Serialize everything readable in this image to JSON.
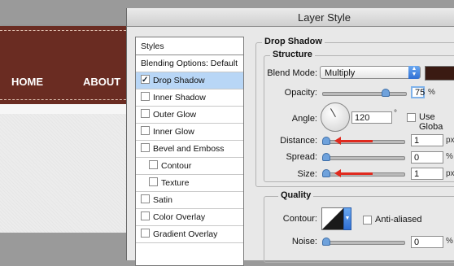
{
  "background": {
    "nav_links": [
      "HOME",
      "ABOUT"
    ]
  },
  "dialog": {
    "title": "Layer Style",
    "styles_list": {
      "header": "Styles",
      "items": [
        {
          "label": "Blending Options: Default",
          "checkbox": false,
          "checked": false,
          "selected": false,
          "indent": false
        },
        {
          "label": "Drop Shadow",
          "checkbox": true,
          "checked": true,
          "selected": true,
          "indent": false
        },
        {
          "label": "Inner Shadow",
          "checkbox": true,
          "checked": false,
          "selected": false,
          "indent": false
        },
        {
          "label": "Outer Glow",
          "checkbox": true,
          "checked": false,
          "selected": false,
          "indent": false
        },
        {
          "label": "Inner Glow",
          "checkbox": true,
          "checked": false,
          "selected": false,
          "indent": false
        },
        {
          "label": "Bevel and Emboss",
          "checkbox": true,
          "checked": false,
          "selected": false,
          "indent": false
        },
        {
          "label": "Contour",
          "checkbox": true,
          "checked": false,
          "selected": false,
          "indent": true
        },
        {
          "label": "Texture",
          "checkbox": true,
          "checked": false,
          "selected": false,
          "indent": true
        },
        {
          "label": "Satin",
          "checkbox": true,
          "checked": false,
          "selected": false,
          "indent": false
        },
        {
          "label": "Color Overlay",
          "checkbox": true,
          "checked": false,
          "selected": false,
          "indent": false
        },
        {
          "label": "Gradient Overlay",
          "checkbox": true,
          "checked": false,
          "selected": false,
          "indent": false
        }
      ]
    },
    "drop_shadow": {
      "section_title": "Drop Shadow",
      "structure_title": "Structure",
      "blend_mode_label": "Blend Mode:",
      "blend_mode_value": "Multiply",
      "shadow_color": "#3a1a12",
      "opacity_label": "Opacity:",
      "opacity_value": "75",
      "opacity_unit": "%",
      "angle_label": "Angle:",
      "angle_value": "120",
      "angle_unit": "°",
      "use_global_label": "Use Globa",
      "use_global_checked": false,
      "distance_label": "Distance:",
      "distance_value": "1",
      "distance_unit": "px",
      "spread_label": "Spread:",
      "spread_value": "0",
      "spread_unit": "%",
      "size_label": "Size:",
      "size_value": "1",
      "size_unit": "px"
    },
    "quality": {
      "section_title": "Quality",
      "contour_label": "Contour:",
      "anti_aliased_label": "Anti-aliased",
      "anti_aliased_checked": false,
      "noise_label": "Noise:",
      "noise_value": "0",
      "noise_unit": "%"
    }
  }
}
